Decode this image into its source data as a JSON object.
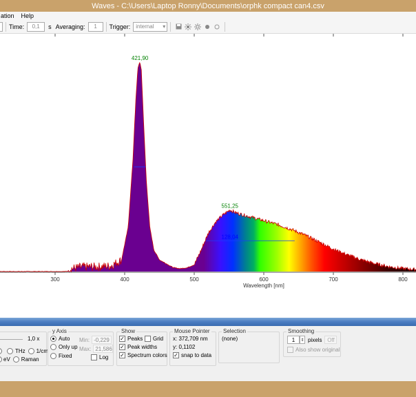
{
  "window": {
    "title": "Waves  -  C:\\Users\\Laptop Ronny\\Documents\\orphk compact can4.csv"
  },
  "menu": {
    "items": [
      "ation",
      "Help"
    ]
  },
  "toolbar": {
    "time_label": "Time:",
    "time_value": "0,1",
    "time_unit": "s",
    "averaging_label": "Averaging:",
    "averaging_value": "1",
    "trigger_label": "Trigger:",
    "trigger_value": "internal"
  },
  "chart_data": {
    "type": "line",
    "xlabel": "Wavelength [nm]",
    "x_ticks": [
      "300",
      "400",
      "500",
      "600",
      "700",
      "800"
    ],
    "xlim": [
      200,
      820
    ],
    "series": [
      {
        "x": [
          200,
          280,
          300,
          315,
          320,
          330,
          340,
          360,
          380,
          395,
          405,
          412,
          416,
          419,
          421.9,
          424,
          427,
          431,
          436,
          442,
          450,
          460,
          470,
          480,
          490,
          500,
          510,
          520,
          530,
          540,
          551.25,
          560,
          580,
          600,
          620,
          640,
          660,
          680,
          700,
          720,
          740,
          760,
          780,
          800,
          820
        ],
        "y": [
          0.0,
          0.0,
          0.0,
          0.0,
          0.1,
          0.2,
          0.3,
          0.3,
          0.4,
          1.0,
          4.5,
          11.5,
          17.5,
          20.8,
          21.4,
          20.6,
          15.5,
          9.5,
          4.6,
          2.2,
          1.2,
          0.8,
          0.4,
          0.3,
          0.4,
          0.7,
          2.2,
          3.9,
          5.0,
          5.7,
          6.3,
          6.0,
          5.6,
          5.2,
          4.8,
          4.3,
          3.7,
          3.0,
          2.3,
          1.7,
          1.2,
          0.8,
          0.5,
          0.3,
          0.2
        ]
      }
    ],
    "annotations": [
      {
        "text": "421,90",
        "x": 421.9,
        "y": 21.4,
        "color": "#008000"
      },
      {
        "text": "551,25",
        "x": 551.25,
        "y": 6.3,
        "color": "#008000"
      },
      {
        "text": "128,04",
        "x": 551.25,
        "y": 3.15,
        "color": "#0000ff"
      }
    ],
    "peak_widths": [
      {
        "x1": 413.6,
        "x2": 430.4,
        "y": 10.7
      },
      {
        "x1": 516.4,
        "x2": 644.4,
        "y": 3.15
      }
    ],
    "spectrum_colors": true
  },
  "scale": {
    "value": "1,0 x",
    "units": [
      "THz",
      "1/cm",
      "eV",
      "Raman"
    ]
  },
  "yaxis": {
    "title": "y Axis",
    "options": [
      "Auto",
      "Only up",
      "Fixed"
    ],
    "selected": "Auto",
    "min_label": "Min:",
    "min_value": "-0,229",
    "max_label": "Max:",
    "max_value": "21,586",
    "log_label": "Log"
  },
  "show": {
    "title": "Show",
    "peaks": "Peaks",
    "grid": "Grid",
    "peak_widths": "Peak widths",
    "spectrum_colors": "Spectrum colors"
  },
  "mouse": {
    "title": "Mouse Pointer",
    "x": "x: 372,709 nm",
    "y": "y: 0,1102",
    "snap": "snap to data"
  },
  "selection": {
    "title": "Selection",
    "value": "(none)"
  },
  "smoothing": {
    "title": "Smoothing",
    "value": "1",
    "unit": "pixels",
    "off": "Off",
    "show_original": "Also show original"
  },
  "colors": {
    "title_bar": "#c9a26b",
    "curve": "#cc0000",
    "peak_label": "#008000",
    "width_label": "#0000ff"
  }
}
